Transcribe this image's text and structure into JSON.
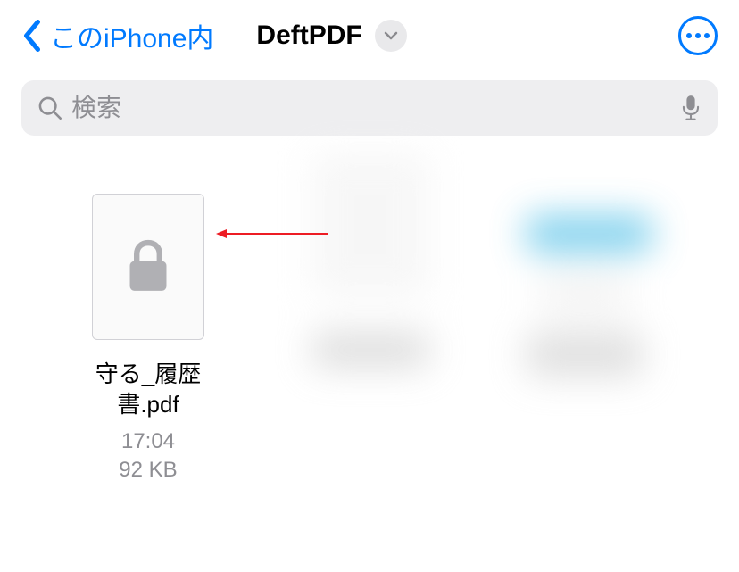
{
  "header": {
    "back_label": "このiPhone内",
    "title": "DeftPDF"
  },
  "search": {
    "placeholder": "検索"
  },
  "files": [
    {
      "name": "守る_履歴書.pdf",
      "time": "17:04",
      "size": "92 KB"
    }
  ],
  "colors": {
    "accent": "#007aff",
    "secondary_text": "#8e8e93",
    "search_bg": "#eeeef0",
    "annotation": "#ed1c24"
  }
}
